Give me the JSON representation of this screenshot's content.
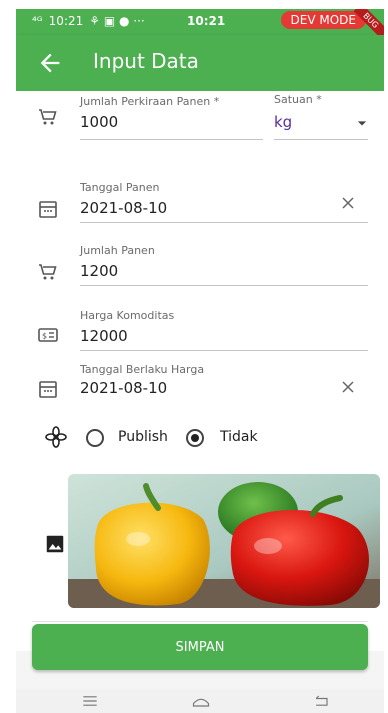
{
  "status_bar": {
    "left_time": "10:21",
    "center_time": "10:21",
    "dev_mode_label": "DEV MODE",
    "debug_banner": "BUG"
  },
  "app_bar": {
    "title": "Input Data"
  },
  "form": {
    "estimate_harvest": {
      "label": "Jumlah Perkiraan Panen *",
      "value": "1000"
    },
    "unit": {
      "label": "Satuan *",
      "value": "kg"
    },
    "harvest_date": {
      "label": "Tanggal Panen",
      "value": "2021-08-10"
    },
    "harvest_amount": {
      "label": "Jumlah Panen",
      "value": "1200"
    },
    "commodity_price": {
      "label": "Harga Komoditas",
      "value": "12000"
    },
    "price_valid_date": {
      "label": "Tanggal Berlaku Harga",
      "value": "2021-08-10"
    },
    "publish": {
      "options": [
        "Publish",
        "Tidak"
      ],
      "selected": "Tidak"
    }
  },
  "actions": {
    "save_label": "SIMPAN"
  },
  "colors": {
    "primary": "#4caf50",
    "dev_badge": "#e53935",
    "unit_text": "#5b2ca0"
  },
  "icons": {
    "cart": "cart-icon",
    "calendar": "calendar-icon",
    "price_tag": "price-tag-icon",
    "flower": "flower-icon",
    "image": "image-icon",
    "clear": "close-icon",
    "back": "arrow-left-icon"
  }
}
